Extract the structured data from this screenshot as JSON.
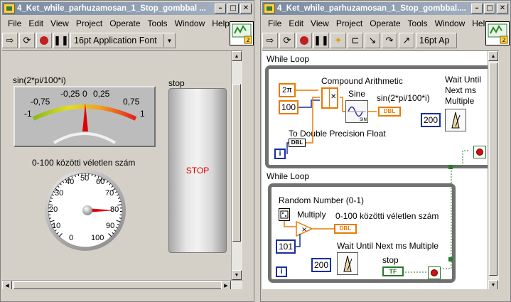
{
  "front_panel": {
    "title": "4_Ket_while_parhuzamosan_1_Stop_gombbal ...",
    "menu": [
      "File",
      "Edit",
      "View",
      "Project",
      "Operate",
      "Tools",
      "Window",
      "Help"
    ],
    "font_selector": "16pt Application Font",
    "meter": {
      "label": "sin(2*pi/100*i)",
      "ticks": [
        "-1",
        "-0,75",
        "-0,25",
        "0",
        "0,25",
        "0,75",
        "1"
      ],
      "value": 0
    },
    "gauge": {
      "label": "0-100 közötti véletlen szám",
      "ticks": [
        "0",
        "10",
        "20",
        "30",
        "40",
        "50",
        "60",
        "70",
        "80",
        "90",
        "100"
      ],
      "value": 82
    },
    "stop": {
      "label": "stop",
      "text": "STOP"
    },
    "colors": {
      "stop_text": "#e00000",
      "needle": "#e00000"
    }
  },
  "block_diagram": {
    "title": "4_Ket_while_parhuzamosan_1_Stop_gombbal....",
    "menu": [
      "File",
      "Edit",
      "View",
      "Project",
      "Operate",
      "Tools",
      "Window",
      "Help"
    ],
    "font_selector": "16pt Ap",
    "loop1": {
      "label": "While Loop",
      "two_pi": "2π",
      "const_100": "100",
      "compound_label": "Compound Arithmetic",
      "sine_label": "Sine",
      "sine_out_label": "sin(2*pi/100*i)",
      "wait_label": "Wait Until Next ms Multiple",
      "wait_value": "200",
      "to_double_label": "To Double Precision Float",
      "i_label": "i",
      "dbl": "DBL"
    },
    "loop2": {
      "label": "While Loop",
      "random_label": "Random Number (0-1)",
      "multiply_label": "Multiply",
      "out_label": "0-100 közötti véletlen szám",
      "const_101": "101",
      "wait_label": "Wait Until Next ms Multiple",
      "wait_value": "200",
      "stop_label": "stop",
      "tf": "TF",
      "i_label": "i",
      "dbl": "DBL"
    }
  }
}
